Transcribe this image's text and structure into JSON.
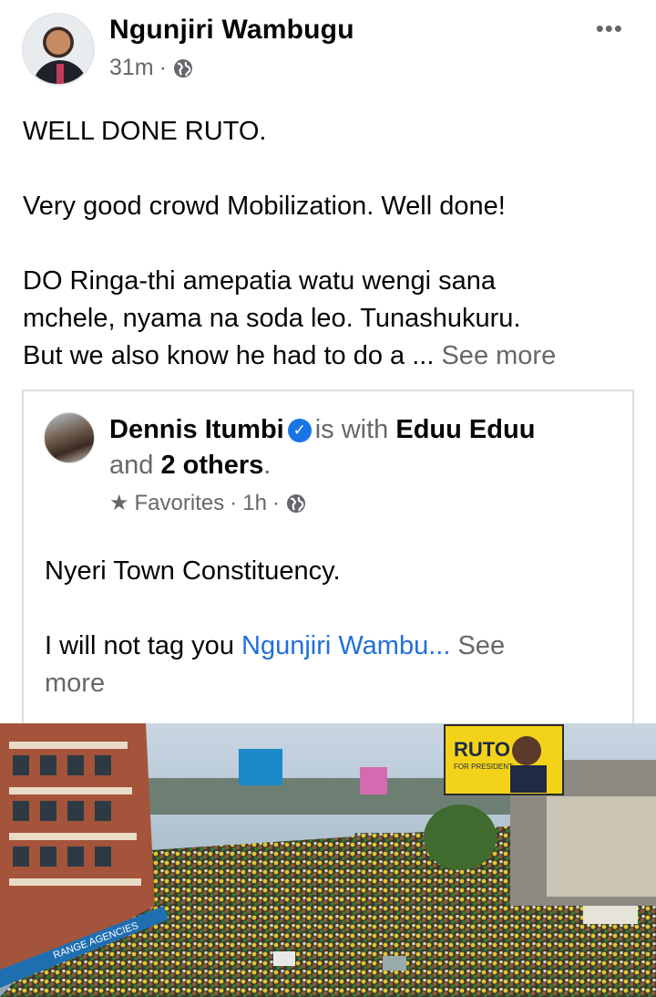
{
  "post": {
    "author": "Ngunjiri Wambugu",
    "time": "31m",
    "separator": "·",
    "more_icon": "•••",
    "lines": [
      "WELL DONE RUTO.",
      "Very good crowd Mobilization. Well done!",
      "DO Ringa-thi amepatia watu wengi sana",
      "mchele, nyama na soda leo. Tunashukuru.",
      "But we also know he had to do a ..."
    ],
    "see_more": "See more"
  },
  "shared": {
    "author": "Dennis Itumbi",
    "verified_mark": "✓",
    "is_with": "is with",
    "tagged": "Eduu Eduu",
    "and": "and",
    "others": "2 others",
    "period": ".",
    "list_name": "Favorites",
    "dot": "·",
    "time": "1h",
    "text_line1": "Nyeri Town Constituency.",
    "text_line2_prefix": "I will not tag you",
    "mention": "Ngunjiri Wambu...",
    "see": "See",
    "more": "more"
  },
  "photo": {
    "billboard_text": "RUTO",
    "billboard_sub": "FOR PRESIDENT",
    "building_sign": "RANGE AGENCIES"
  },
  "colors": {
    "text": "#050505",
    "secondary": "#65676b",
    "link": "#216fdb",
    "verified": "#1b74e4",
    "billboard": "#f3d31a"
  }
}
